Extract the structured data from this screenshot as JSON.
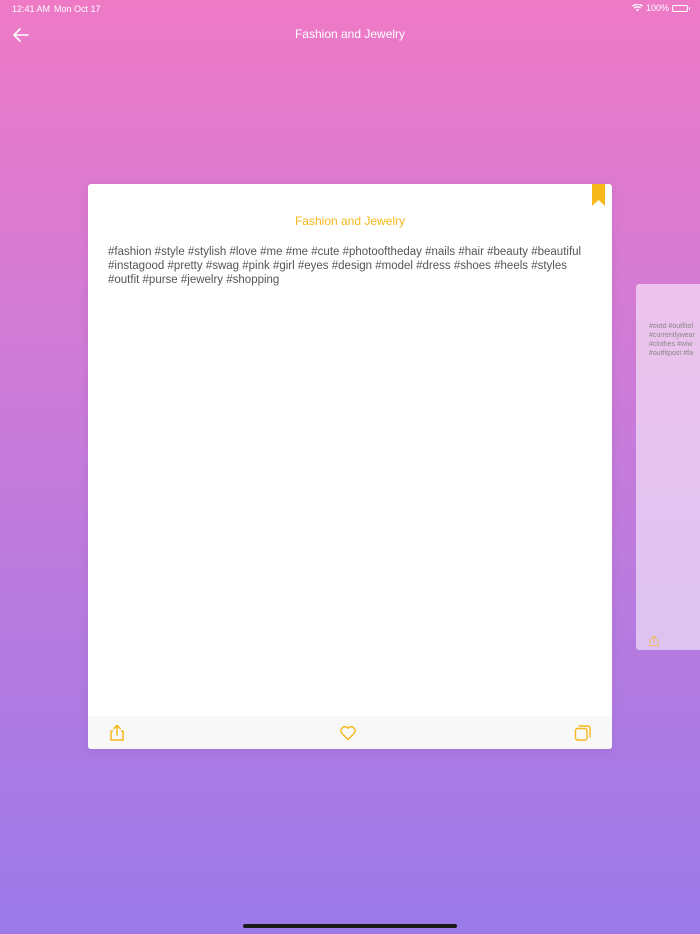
{
  "status_bar": {
    "time": "12:41 AM",
    "date": "Mon Oct 17",
    "battery": "100%"
  },
  "nav": {
    "title": "Fashion and Jewelry",
    "back_icon": "arrow-left-icon"
  },
  "card": {
    "title": "Fashion and Jewelry",
    "text": "#fashion #style #stylish #love #me #me #cute #photooftheday #nails #hair #beauty #beautiful #instagood #pretty #swag #pink #girl #eyes #design #model #dress #shoes #heels #styles #outfit #purse #jewelry #shopping",
    "bookmark_icon": "bookmark-icon",
    "footer": {
      "share_icon": "share-icon",
      "favorite_icon": "heart-icon",
      "copy_icon": "copy-icon"
    }
  },
  "peek_card": {
    "text": "#ootd #outfitof\n#currentlywear\n#clothes #wiw\n#outfitpost #fa",
    "share_icon": "share-icon"
  },
  "colors": {
    "accent": "#f6b81b",
    "gradient_top": "#ee7ac6",
    "gradient_bottom": "#9a7ae9",
    "card_text": "#555555"
  }
}
